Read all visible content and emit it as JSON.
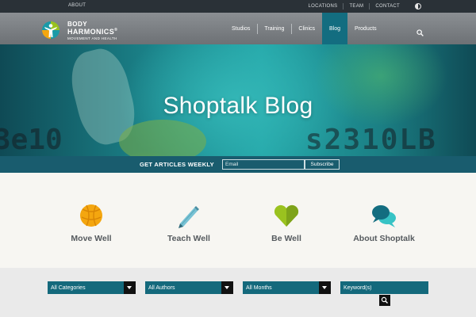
{
  "topbar": {
    "about": "ABOUT",
    "links": [
      "LOCATIONS",
      "TEAM",
      "CONTACT"
    ],
    "contrast_icon": "contrast-toggle-icon"
  },
  "brand": {
    "line1": "BODY",
    "line2": "HARMONICS",
    "registered": "®",
    "tagline": "MOVEMENT AND HEALTH",
    "logo_icon": "figure-logo-icon"
  },
  "nav": {
    "items": [
      "Studios",
      "Training",
      "Clinics",
      "Blog",
      "Products"
    ],
    "active": "Blog",
    "search_icon": "search-icon"
  },
  "hero": {
    "title": "Shoptalk Blog",
    "bg_text_left": "3e10",
    "bg_text_right": "s2310LB"
  },
  "subscribe": {
    "label": "GET ARTICLES WEEKLY",
    "email_placeholder": "Email",
    "button": "Subscribe"
  },
  "categories": [
    {
      "name": "Move Well",
      "icon": "ball-icon",
      "color": "#f4a60f"
    },
    {
      "name": "Teach Well",
      "icon": "pencil-icon",
      "color": "#78c2d4"
    },
    {
      "name": "Be Well",
      "icon": "heart-icon",
      "color": "#9ac21f"
    },
    {
      "name": "About Shoptalk",
      "icon": "speech-bubbles-icon",
      "color": "#1aa7ad"
    }
  ],
  "filters": {
    "categories": "All Categories",
    "authors": "All Authors",
    "months": "All Months",
    "keyword_placeholder": "Keyword(s)",
    "search_icon": "search-icon"
  },
  "colors": {
    "accent": "#14697c",
    "topbar": "#2a3137",
    "nav": "#7c8084",
    "category_text": "#555a5e"
  }
}
